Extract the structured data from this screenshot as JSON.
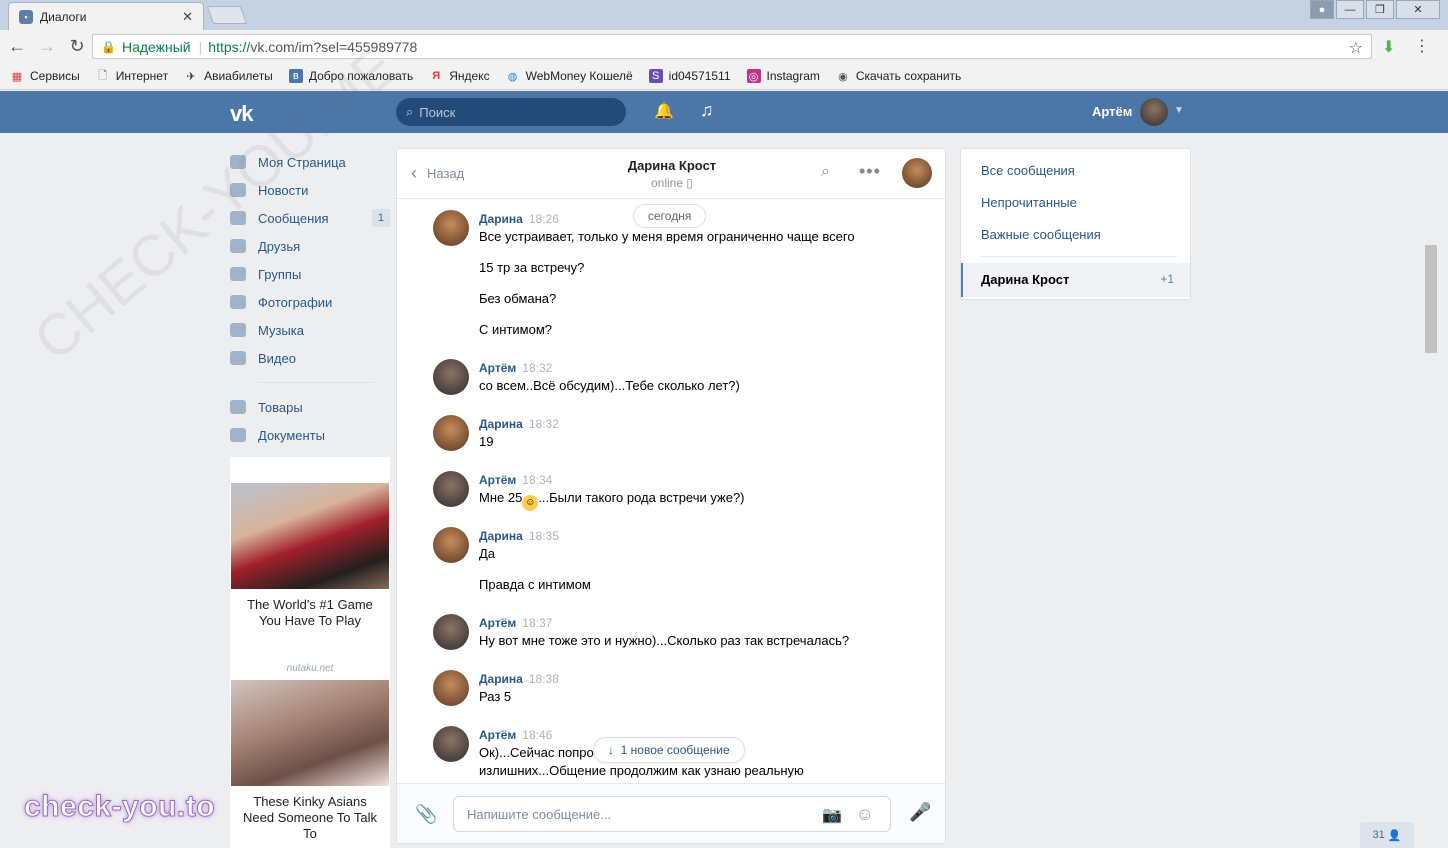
{
  "browser": {
    "tab_title": "Диалоги",
    "secure_label": "Надежный",
    "url_proto": "https://",
    "url_rest": "vk.com/im?sel=455989778",
    "bookmarks": [
      "Сервисы",
      "Интернет",
      "Авиабилеты",
      "Добро пожаловать",
      "Яндекс",
      "WebMoney Кошелё",
      "id04571511",
      "Instagram",
      "Скачать сохранить"
    ]
  },
  "header": {
    "search_placeholder": "Поиск",
    "user_name": "Артём"
  },
  "nav": {
    "items": [
      {
        "label": "Моя Страница"
      },
      {
        "label": "Новости"
      },
      {
        "label": "Сообщения",
        "count": "1"
      },
      {
        "label": "Друзья"
      },
      {
        "label": "Группы"
      },
      {
        "label": "Фотографии"
      },
      {
        "label": "Музыка"
      },
      {
        "label": "Видео"
      },
      {
        "label": "Товары"
      },
      {
        "label": "Документы"
      }
    ]
  },
  "ads": [
    {
      "title": "The World's #1 Game You Have To Play",
      "source": "nutaku.net"
    },
    {
      "title": "These Kinky Asians Need Someone To Talk To"
    }
  ],
  "chat": {
    "back_label": "Назад",
    "title": "Дарина Крост",
    "status": "online",
    "date_chip": "сегодня",
    "new_message_chip": "1 новое сообщение",
    "composer_placeholder": "Напишите сообщение...",
    "messages": [
      {
        "name": "Дарина",
        "time": "18:26",
        "lines": [
          "Все устраивает, только у меня время ограниченно чаще всего",
          "15 тр за встречу?",
          "Без обмана?",
          "С интимом?"
        ]
      },
      {
        "name": "Артём",
        "time": "18:32",
        "lines": [
          "со всем..Всё обсудим)...Тебе сколько лет?)"
        ]
      },
      {
        "name": "Дарина",
        "time": "18:32",
        "lines": [
          "19"
        ]
      },
      {
        "name": "Артём",
        "time": "18:34",
        "lines": [
          "Мне 25",
          "...Были такого рода встречи уже?)"
        ]
      },
      {
        "name": "Дарина",
        "time": "18:35",
        "lines": [
          "Да",
          "Правда с интимом"
        ]
      },
      {
        "name": "Артём",
        "time": "18:37",
        "lines": [
          "Ну вот мне тоже это и нужно)...Сколько раз так встречалась?"
        ]
      },
      {
        "name": "Дарина",
        "time": "18:38",
        "lines": [
          "Раз 5"
        ]
      },
      {
        "name": "Артём",
        "time": "18:46",
        "lines": [
          "Ок)...Сейчас попро",
          "излишних...Общение продолжим как узнаю реальную"
        ]
      }
    ]
  },
  "right_panel": {
    "filters": [
      "Все сообщения",
      "Непрочитанные",
      "Важные сообщения"
    ],
    "active_dialog": "Дарина Крост",
    "active_count": "+1"
  },
  "friends_counter": "31",
  "watermark": "check-you.to",
  "watermark_diag": "CHECK-YOU.ME"
}
